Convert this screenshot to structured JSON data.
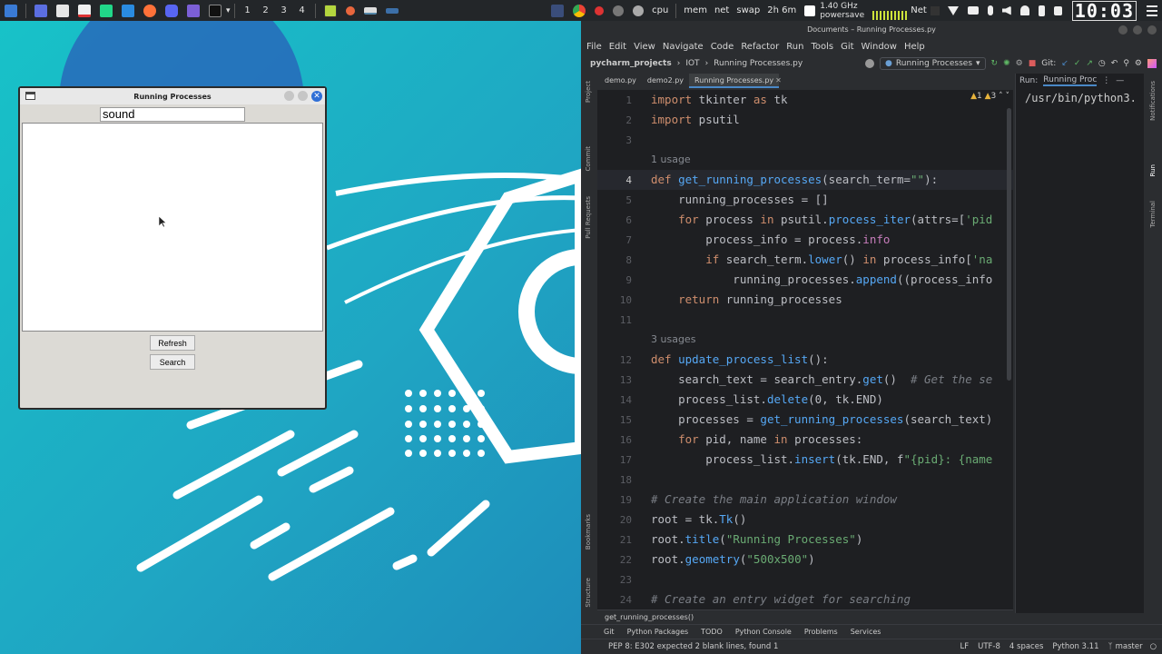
{
  "taskbar": {
    "workspaces": [
      "1",
      "2",
      "3",
      "4"
    ],
    "tray": {
      "cpu": "cpu",
      "mem": "mem",
      "net": "net",
      "swap": "swap",
      "uptime": "2h 6m",
      "cpu_freq": "1.40 GHz",
      "power_mode": "powersave",
      "net_label": "Net",
      "clock": "10:03"
    }
  },
  "tk_window": {
    "title": "Running Processes",
    "search_value": "sound",
    "refresh_label": "Refresh",
    "search_label": "Search"
  },
  "ide": {
    "title": "Documents – Running Processes.py",
    "menu": [
      "File",
      "Edit",
      "View",
      "Navigate",
      "Code",
      "Refactor",
      "Run",
      "Tools",
      "Git",
      "Window",
      "Help"
    ],
    "breadcrumb": [
      "pycharm_projects",
      "IOT",
      "Running Processes.py"
    ],
    "run_config": "Running Processes",
    "git_label": "Git:",
    "tabs": [
      "demo.py",
      "demo2.py",
      "Running Processes.py"
    ],
    "inspections": {
      "warnings": "1",
      "weak_warnings": "3"
    },
    "run_panel": {
      "label": "Run:",
      "tab": "Running Proc",
      "output": "/usr/bin/python3."
    },
    "side_left": [
      "Project",
      "Commit",
      "Pull Requests",
      "Bookmarks",
      "Structure"
    ],
    "side_right": [
      "Notifications",
      "Run",
      "Terminal"
    ],
    "code_crumb": "get_running_processes()",
    "tool_tabs": [
      "Git",
      "Python Packages",
      "TODO",
      "Python Console",
      "Problems",
      "Services"
    ],
    "status": {
      "message": "PEP 8: E302 expected 2 blank lines, found 1",
      "line_sep": "LF",
      "encoding": "UTF-8",
      "indent": "4 spaces",
      "interpreter": "Python 3.11",
      "branch": "master"
    },
    "hints": {
      "usage1": "1 usage",
      "usage3": "3 usages"
    },
    "code": {
      "l1_a": "import",
      "l1_b": " tkinter ",
      "l1_c": "as",
      "l1_d": " tk",
      "l2_a": "import",
      "l2_b": " psutil",
      "l4_a": "def",
      "l4_b": "get_running_processes",
      "l4_c": "(search_term=",
      "l4_d": "\"\"",
      "l4_e": "):",
      "l5": "    running_processes = []",
      "l6_a": "    ",
      "l6_b": "for",
      "l6_c": " process ",
      "l6_d": "in",
      "l6_e": " psutil.",
      "l6_f": "process_iter",
      "l6_g": "(attrs=[",
      "l6_h": "'pid",
      "l7_a": "        process_info = process.",
      "l7_b": "info",
      "l8_a": "        ",
      "l8_b": "if",
      "l8_c": " search_term.",
      "l8_d": "lower",
      "l8_e": "() ",
      "l8_f": "in",
      "l8_g": " process_info[",
      "l8_h": "'na",
      "l9_a": "            running_processes.",
      "l9_b": "append",
      "l9_c": "((process_info",
      "l10_a": "    ",
      "l10_b": "return",
      "l10_c": " running_processes",
      "l12_a": "def",
      "l12_b": "update_process_list",
      "l12_c": "():",
      "l13_a": "    search_text = search_entry.",
      "l13_b": "get",
      "l13_c": "()  ",
      "l13_d": "# Get the se",
      "l14_a": "    process_list.",
      "l14_b": "delete",
      "l14_c": "(0, tk.END)",
      "l15_a": "    processes = ",
      "l15_b": "get_running_processes",
      "l15_c": "(search_text)",
      "l16_a": "    ",
      "l16_b": "for",
      "l16_c": " pid, name ",
      "l16_d": "in",
      "l16_e": " processes:",
      "l17_a": "        process_list.",
      "l17_b": "insert",
      "l17_c": "(tk.END, f",
      "l17_d": "\"{pid}: {name",
      "l19": "# Create the main application window",
      "l20_a": "root = tk.",
      "l20_b": "Tk",
      "l20_c": "()",
      "l21_a": "root.",
      "l21_b": "title",
      "l21_c": "(",
      "l21_d": "\"Running Processes\"",
      "l21_e": ")",
      "l22_a": "root.",
      "l22_b": "geometry",
      "l22_c": "(",
      "l22_d": "\"500x500\"",
      "l22_e": ")",
      "l24": "# Create an entry widget for searching"
    }
  }
}
